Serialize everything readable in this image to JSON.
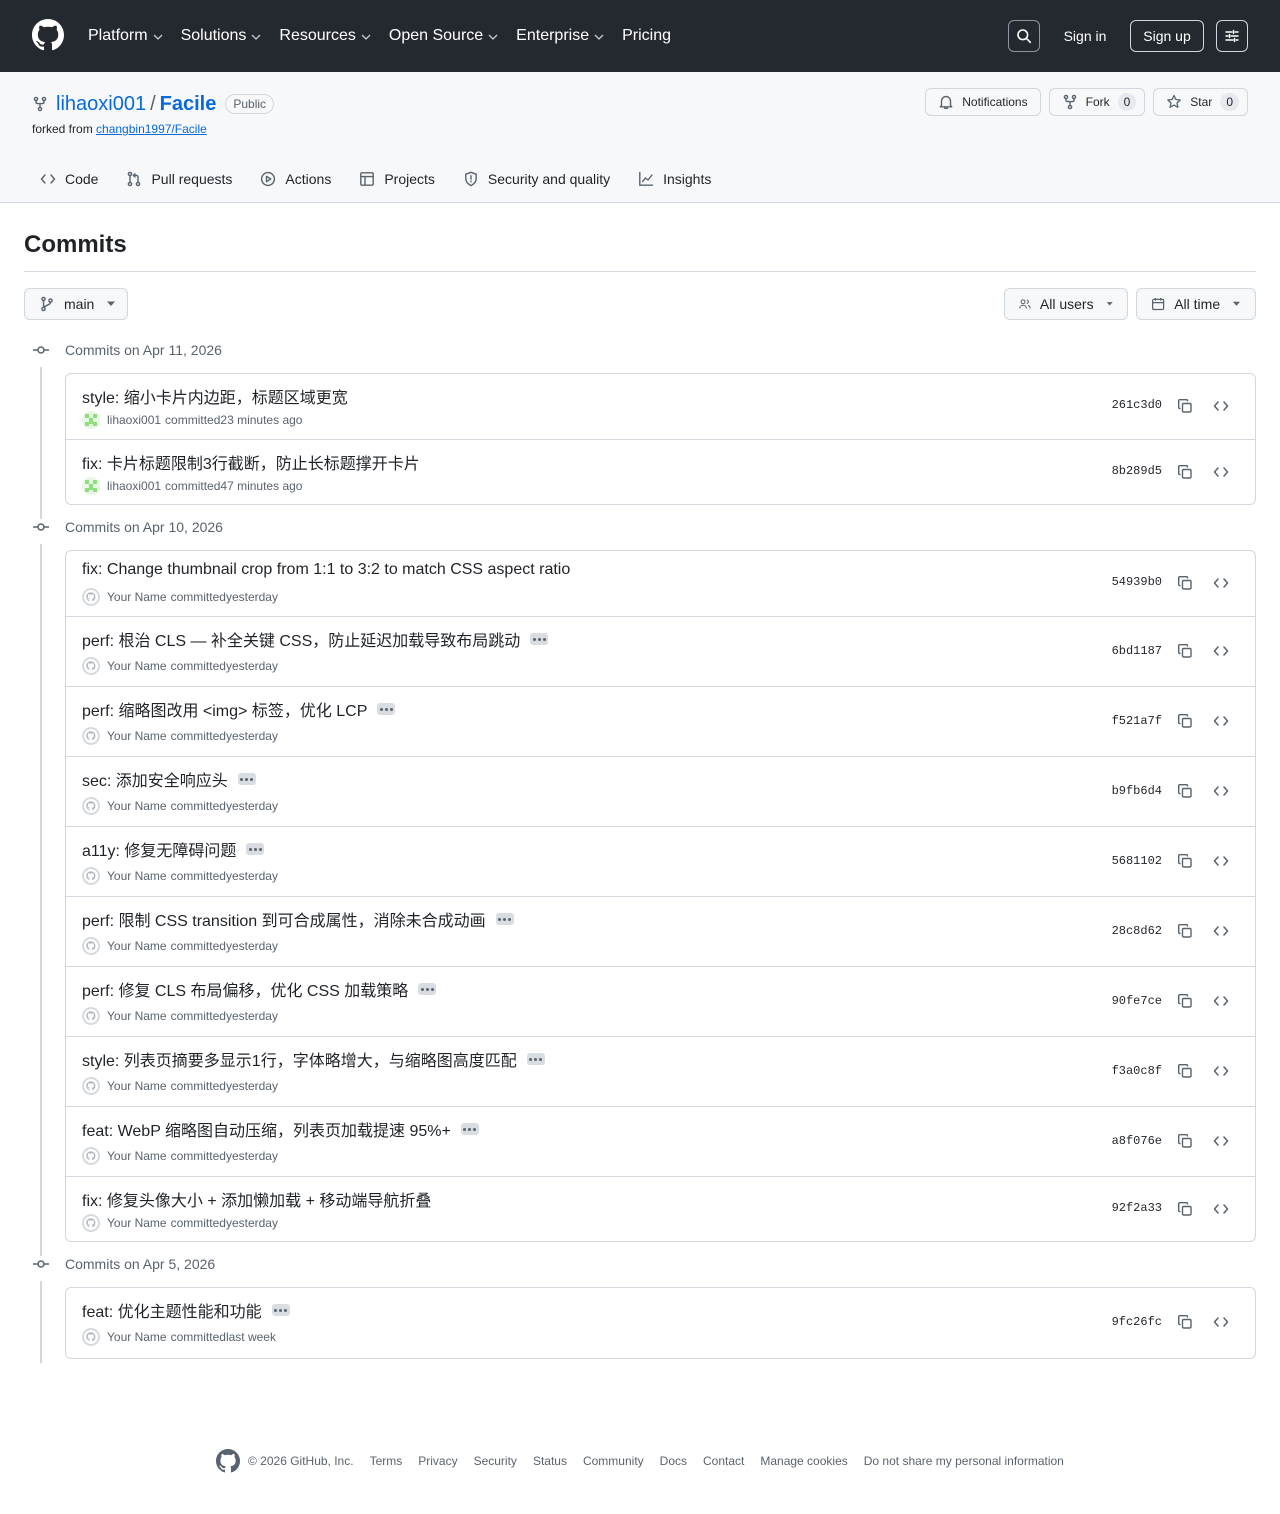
{
  "header": {
    "nav": [
      {
        "label": "Platform",
        "has_dropdown": true
      },
      {
        "label": "Solutions",
        "has_dropdown": true
      },
      {
        "label": "Resources",
        "has_dropdown": true
      },
      {
        "label": "Open Source",
        "has_dropdown": true
      },
      {
        "label": "Enterprise",
        "has_dropdown": true
      },
      {
        "label": "Pricing",
        "has_dropdown": false
      }
    ],
    "sign_in": "Sign in",
    "sign_up": "Sign up"
  },
  "repo": {
    "owner": "lihaoxi001",
    "separator": "/",
    "name": "Facile",
    "visibility": "Public",
    "forked_from_prefix": "forked from",
    "forked_from_link": "changbin1997/Facile",
    "notifications": "Notifications",
    "fork_label": "Fork",
    "fork_count": "0",
    "star_label": "Star",
    "star_count": "0",
    "tabs": [
      {
        "label": "Code",
        "icon": "code-icon"
      },
      {
        "label": "Pull requests",
        "icon": "pull-request-icon"
      },
      {
        "label": "Actions",
        "icon": "play-icon"
      },
      {
        "label": "Projects",
        "icon": "table-icon"
      },
      {
        "label": "Security and quality",
        "icon": "shield-icon"
      },
      {
        "label": "Insights",
        "icon": "graph-icon"
      }
    ]
  },
  "page": {
    "title": "Commits",
    "branch": "main",
    "users_filter": "All users",
    "time_filter": "All time"
  },
  "commit_groups": [
    {
      "heading": "Commits on Apr 11, 2026",
      "commits": [
        {
          "message": "style: 缩小卡片内边距，标题区域更宽",
          "author": "lihaoxi001",
          "action": "committed",
          "time": "23 minutes ago",
          "sha": "261c3d0",
          "has_more": false,
          "avatar": "identicon"
        },
        {
          "message": "fix: 卡片标题限制3行截断，防止长标题撑开卡片",
          "author": "lihaoxi001",
          "action": "committed",
          "time": "47 minutes ago",
          "sha": "8b289d5",
          "has_more": false,
          "avatar": "identicon"
        }
      ]
    },
    {
      "heading": "Commits on Apr 10, 2026",
      "commits": [
        {
          "message": "fix: Change thumbnail crop from 1:1 to 3:2 to match CSS aspect ratio",
          "author": "Your Name",
          "action": "committed",
          "time": "yesterday",
          "sha": "54939b0",
          "has_more": false,
          "avatar": "default"
        },
        {
          "message": "perf: 根治 CLS — 补全关键 CSS，防止延迟加载导致布局跳动",
          "author": "Your Name",
          "action": "committed",
          "time": "yesterday",
          "sha": "6bd1187",
          "has_more": true,
          "avatar": "default"
        },
        {
          "message": "perf: 缩略图改用 <img> 标签，优化 LCP",
          "author": "Your Name",
          "action": "committed",
          "time": "yesterday",
          "sha": "f521a7f",
          "has_more": true,
          "avatar": "default"
        },
        {
          "message": "sec: 添加安全响应头",
          "author": "Your Name",
          "action": "committed",
          "time": "yesterday",
          "sha": "b9fb6d4",
          "has_more": true,
          "avatar": "default"
        },
        {
          "message": "a11y: 修复无障碍问题",
          "author": "Your Name",
          "action": "committed",
          "time": "yesterday",
          "sha": "5681102",
          "has_more": true,
          "avatar": "default"
        },
        {
          "message": "perf: 限制 CSS transition 到可合成属性，消除未合成动画",
          "author": "Your Name",
          "action": "committed",
          "time": "yesterday",
          "sha": "28c8d62",
          "has_more": true,
          "avatar": "default"
        },
        {
          "message": "perf: 修复 CLS 布局偏移，优化 CSS 加载策略",
          "author": "Your Name",
          "action": "committed",
          "time": "yesterday",
          "sha": "90fe7ce",
          "has_more": true,
          "avatar": "default"
        },
        {
          "message": "style: 列表页摘要多显示1行，字体略增大，与缩略图高度匹配",
          "author": "Your Name",
          "action": "committed",
          "time": "yesterday",
          "sha": "f3a0c8f",
          "has_more": true,
          "avatar": "default"
        },
        {
          "message": "feat: WebP 缩略图自动压缩，列表页加载提速 95%+",
          "author": "Your Name",
          "action": "committed",
          "time": "yesterday",
          "sha": "a8f076e",
          "has_more": true,
          "avatar": "default"
        },
        {
          "message": "fix: 修复头像大小 + 添加懒加载 + 移动端导航折叠",
          "author": "Your Name",
          "action": "committed",
          "time": "yesterday",
          "sha": "92f2a33",
          "has_more": false,
          "avatar": "default"
        }
      ]
    },
    {
      "heading": "Commits on Apr 5, 2026",
      "commits": [
        {
          "message": "feat: 优化主题性能和功能",
          "author": "Your Name",
          "action": "committed",
          "time": "last week",
          "sha": "9fc26fc",
          "has_more": true,
          "avatar": "default"
        }
      ]
    }
  ],
  "footer": {
    "copyright": "© 2026 GitHub, Inc.",
    "links": [
      "Terms",
      "Privacy",
      "Security",
      "Status",
      "Community",
      "Docs",
      "Contact",
      "Manage cookies",
      "Do not share my personal information"
    ]
  },
  "colors": {
    "header_bg": "#24292f",
    "link": "#0969da",
    "border": "#d0d7de",
    "muted_text": "#59636e",
    "identicon": "#8ddf7a"
  }
}
